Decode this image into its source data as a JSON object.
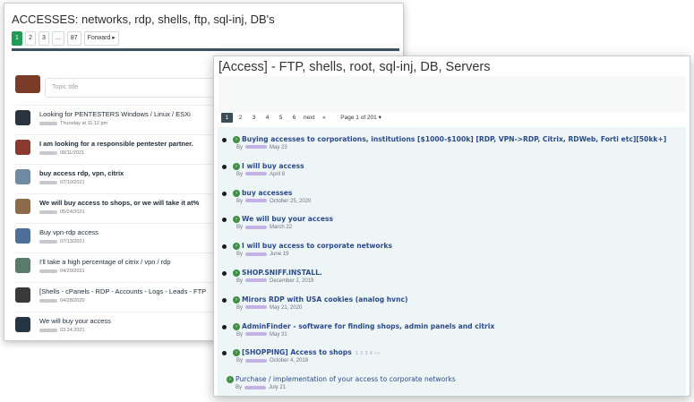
{
  "back": {
    "title": "ACCESSES: networks, rdp, shells, ftp, sql-inj, DB's",
    "pages": [
      "1",
      "2",
      "3",
      "...",
      "87",
      "Forward ▸"
    ],
    "topic_placeholder": "Topic title",
    "threads": [
      {
        "title": "Looking for PENTESTERS Windows / Linux / ESXi",
        "meta": "Thursday at 11:12 pm",
        "bold": false,
        "color": "#2a3440"
      },
      {
        "title": "I am looking for a responsible pentester partner.",
        "meta": "08/11/2021",
        "bold": true,
        "color": "#8a3a2f"
      },
      {
        "title": "buy access rdp, vpn, citrix",
        "meta": "07/10/2021",
        "bold": true,
        "color": "#6f8aa2"
      },
      {
        "title": "We will buy access to shops, or we will take it at%",
        "meta": "05/24/2021",
        "bold": true,
        "color": "#8c6a4a"
      },
      {
        "title": "Buy vpn-rdp access",
        "meta": "07/13/2021",
        "bold": false,
        "color": "#4d6f99"
      },
      {
        "title": "I'll take a high percentage of citrix / vpn / rdp",
        "meta": "04/29/2021",
        "bold": false,
        "color": "#5a7a6a"
      },
      {
        "title": "[Shells - cPanels - RDP - Accounts - Logs - Leads - FTP",
        "meta": "04/28/2020",
        "bold": false,
        "color": "#3a3a3a"
      },
      {
        "title": "We will buy your access",
        "meta": "03.24.2021",
        "bold": false,
        "color": "#263544"
      }
    ]
  },
  "front": {
    "title": "[Access] - FTP, shells, root, sql-inj, DB, Servers",
    "pages": [
      "1",
      "2",
      "3",
      "4",
      "5",
      "6",
      "next",
      "»"
    ],
    "page_of": "Page 1 of 201 ▾",
    "threads": [
      {
        "title": "Buying accesses to corporations, institutions [$1000-$100k] [RDP, VPN->RDP, Citrix, RDWeb, Forti etc][50kk+]",
        "date": "May 23",
        "bold": true,
        "small_pages": ""
      },
      {
        "title": "I will buy access",
        "date": "April 8",
        "bold": true,
        "small_pages": ""
      },
      {
        "title": "buy accesses",
        "date": "October 25, 2020",
        "bold": true,
        "small_pages": ""
      },
      {
        "title": "We will buy your access",
        "date": "March 22",
        "bold": true,
        "small_pages": ""
      },
      {
        "title": "I will buy access to corporate networks",
        "date": "June 19",
        "bold": true,
        "small_pages": ""
      },
      {
        "title": "SHOP.SNIFF.INSTALL.",
        "date": "December 2, 2019",
        "bold": true,
        "small_pages": ""
      },
      {
        "title": "Mirors RDP with USA cookies (analog hvnc)",
        "date": "May 21, 2020",
        "bold": true,
        "small_pages": ""
      },
      {
        "title": "AdminFinder - software for finding shops, admin panels and citrix",
        "date": "May 31",
        "bold": true,
        "small_pages": ""
      },
      {
        "title": "[SHOPPING] Access to shops",
        "date": "October 4, 2018",
        "bold": true,
        "small_pages": "1 2 3 4 »»"
      },
      {
        "title": "Purchase / implementation of your access to corporate networks",
        "date": "July 21",
        "bold": false,
        "small_pages": ""
      }
    ]
  },
  "by_label": "By"
}
